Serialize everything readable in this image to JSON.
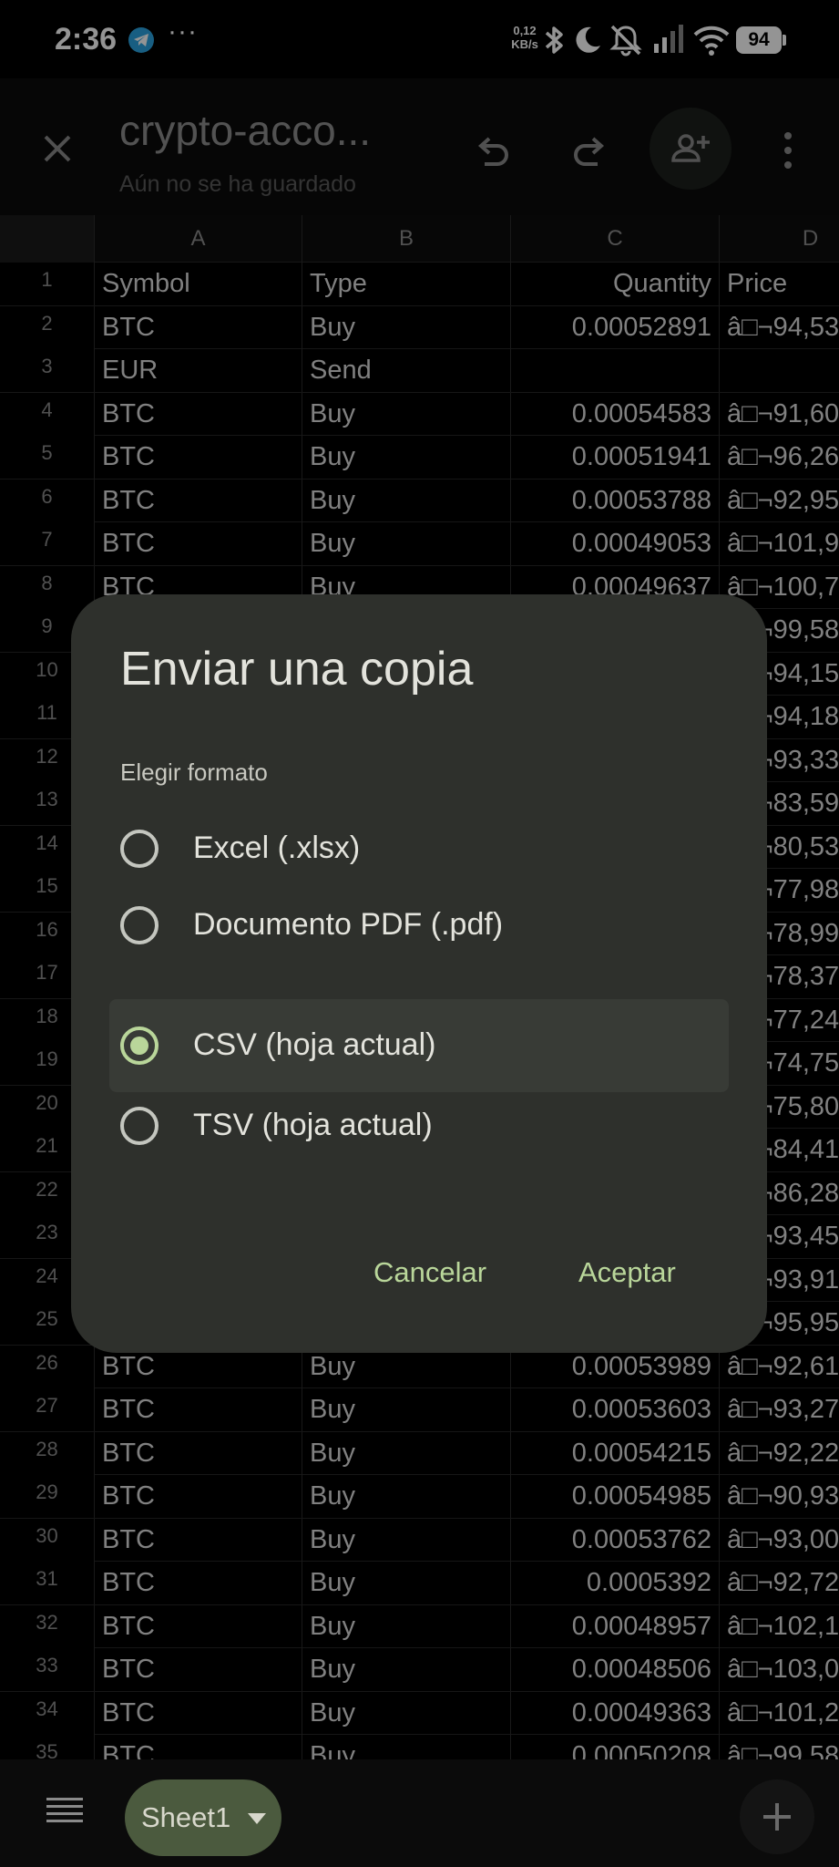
{
  "status_bar": {
    "time": "2:36",
    "more": "···",
    "net_speed": "0,12",
    "net_unit": "KB/s",
    "battery": "94"
  },
  "toolbar": {
    "title": "crypto-acco...",
    "subtitle": "Aún no se ha guardado"
  },
  "sheet": {
    "columns": [
      "A",
      "B",
      "C",
      "D"
    ],
    "rows": [
      {
        "n": "1",
        "a": "Symbol",
        "b": "Type",
        "c": "Quantity",
        "d": "Price"
      },
      {
        "n": "2",
        "a": "BTC",
        "b": "Buy",
        "c": "0.00052891",
        "d": "â□¬94,53"
      },
      {
        "n": "3",
        "a": "EUR",
        "b": "Send",
        "c": "",
        "d": ""
      },
      {
        "n": "4",
        "a": "BTC",
        "b": "Buy",
        "c": "0.00054583",
        "d": "â□¬91,60"
      },
      {
        "n": "5",
        "a": "BTC",
        "b": "Buy",
        "c": "0.00051941",
        "d": "â□¬96,26"
      },
      {
        "n": "6",
        "a": "BTC",
        "b": "Buy",
        "c": "0.00053788",
        "d": "â□¬92,95"
      },
      {
        "n": "7",
        "a": "BTC",
        "b": "Buy",
        "c": "0.00049053",
        "d": "â□¬101,9"
      },
      {
        "n": "8",
        "a": "BTC",
        "b": "Buy",
        "c": "0.00049637",
        "d": "â□¬100,7"
      },
      {
        "n": "9",
        "a": "",
        "b": "",
        "c": "",
        "d": "â□¬99,58"
      },
      {
        "n": "10",
        "a": "",
        "b": "",
        "c": "",
        "d": "â□¬94,15"
      },
      {
        "n": "11",
        "a": "",
        "b": "",
        "c": "",
        "d": "â□¬94,18"
      },
      {
        "n": "12",
        "a": "",
        "b": "",
        "c": "",
        "d": "â□¬93,33"
      },
      {
        "n": "13",
        "a": "",
        "b": "",
        "c": "",
        "d": "â□¬83,59"
      },
      {
        "n": "14",
        "a": "",
        "b": "",
        "c": "",
        "d": "â□¬80,53"
      },
      {
        "n": "15",
        "a": "",
        "b": "",
        "c": "",
        "d": "â□¬77,98"
      },
      {
        "n": "16",
        "a": "",
        "b": "",
        "c": "",
        "d": "â□¬78,99"
      },
      {
        "n": "17",
        "a": "",
        "b": "",
        "c": "",
        "d": "â□¬78,37"
      },
      {
        "n": "18",
        "a": "",
        "b": "",
        "c": "",
        "d": "â□¬77,24"
      },
      {
        "n": "19",
        "a": "",
        "b": "",
        "c": "",
        "d": "â□¬74,75"
      },
      {
        "n": "20",
        "a": "",
        "b": "",
        "c": "",
        "d": "â□¬75,80"
      },
      {
        "n": "21",
        "a": "",
        "b": "",
        "c": "",
        "d": "â□¬84,41"
      },
      {
        "n": "22",
        "a": "",
        "b": "",
        "c": "",
        "d": "â□¬86,28"
      },
      {
        "n": "23",
        "a": "",
        "b": "",
        "c": "",
        "d": "â□¬93,45"
      },
      {
        "n": "24",
        "a": "",
        "b": "",
        "c": "",
        "d": "â□¬93,91"
      },
      {
        "n": "25",
        "a": "",
        "b": "",
        "c": "",
        "d": "â□¬95,95"
      },
      {
        "n": "26",
        "a": "BTC",
        "b": "Buy",
        "c": "0.00053989",
        "d": "â□¬92,61"
      },
      {
        "n": "27",
        "a": "BTC",
        "b": "Buy",
        "c": "0.00053603",
        "d": "â□¬93,27"
      },
      {
        "n": "28",
        "a": "BTC",
        "b": "Buy",
        "c": "0.00054215",
        "d": "â□¬92,22"
      },
      {
        "n": "29",
        "a": "BTC",
        "b": "Buy",
        "c": "0.00054985",
        "d": "â□¬90,93"
      },
      {
        "n": "30",
        "a": "BTC",
        "b": "Buy",
        "c": "0.00053762",
        "d": "â□¬93,00"
      },
      {
        "n": "31",
        "a": "BTC",
        "b": "Buy",
        "c": "0.0005392",
        "d": "â□¬92,72"
      },
      {
        "n": "32",
        "a": "BTC",
        "b": "Buy",
        "c": "0.00048957",
        "d": "â□¬102,1"
      },
      {
        "n": "33",
        "a": "BTC",
        "b": "Buy",
        "c": "0.00048506",
        "d": "â□¬103,0"
      },
      {
        "n": "34",
        "a": "BTC",
        "b": "Buy",
        "c": "0.00049363",
        "d": "â□¬101,2"
      },
      {
        "n": "35",
        "a": "BTC",
        "b": "Buy",
        "c": "0.00050208",
        "d": "â□¬99,58"
      }
    ]
  },
  "dialog": {
    "title": "Enviar una copia",
    "subtitle": "Elegir formato",
    "options": [
      {
        "label": "Excel (.xlsx)",
        "selected": false
      },
      {
        "label": "Documento PDF (.pdf)",
        "selected": false
      },
      {
        "label": "CSV (hoja actual)",
        "selected": true
      },
      {
        "label": "TSV (hoja actual)",
        "selected": false
      }
    ],
    "cancel_label": "Cancelar",
    "accept_label": "Aceptar"
  },
  "bottom_bar": {
    "sheet_tab": "Sheet1"
  },
  "colors": {
    "accent": "#b9d69a",
    "dialog_bg": "#2e302c",
    "sheet_tab_bg": "#4b5a3e"
  }
}
